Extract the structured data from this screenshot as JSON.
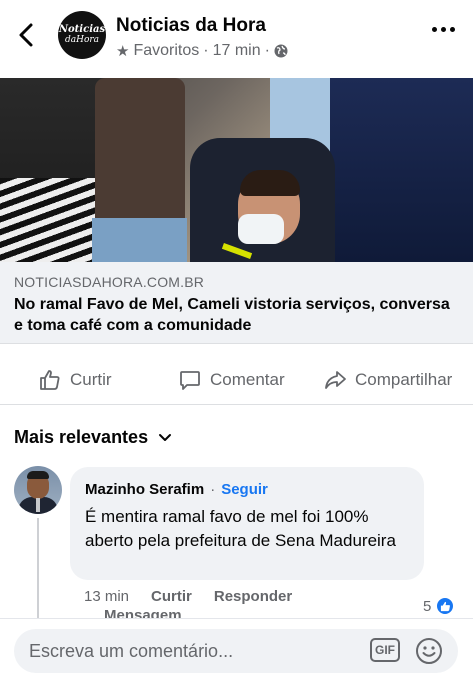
{
  "post": {
    "page_name": "Noticias da Hora",
    "logo_line1": "Noticias",
    "logo_line2": "daHora",
    "audience": "Favoritos",
    "time": "17 min",
    "separator": "·"
  },
  "link": {
    "domain": "NOTICIASDAHORA.COM.BR",
    "title": "No ramal Favo de Mel, Cameli vistoria serviços, conversa e toma café com a comunidade"
  },
  "actions": {
    "like": "Curtir",
    "comment": "Comentar",
    "share": "Compartilhar"
  },
  "sort": {
    "label": "Mais relevantes"
  },
  "comment": {
    "author": "Mazinho Serafim",
    "separator": "·",
    "follow": "Seguir",
    "text": "É mentira ramal favo de mel foi 100% aberto pela prefeitura de Sena Madureira",
    "time": "13 min",
    "like": "Curtir",
    "reply": "Responder",
    "message": "Mensagem",
    "reaction_count": "5"
  },
  "composer": {
    "placeholder": "Escreva um comentário...",
    "gif": "GIF"
  },
  "colors": {
    "accent": "#1877f2",
    "muted": "#65676b",
    "bubble": "#f0f2f5"
  },
  "icons": [
    "back-arrow-icon",
    "star-icon",
    "globe-icon",
    "more-icon",
    "like-icon",
    "comment-icon",
    "share-icon",
    "chevron-down-icon",
    "gif-icon",
    "emoji-icon"
  ]
}
